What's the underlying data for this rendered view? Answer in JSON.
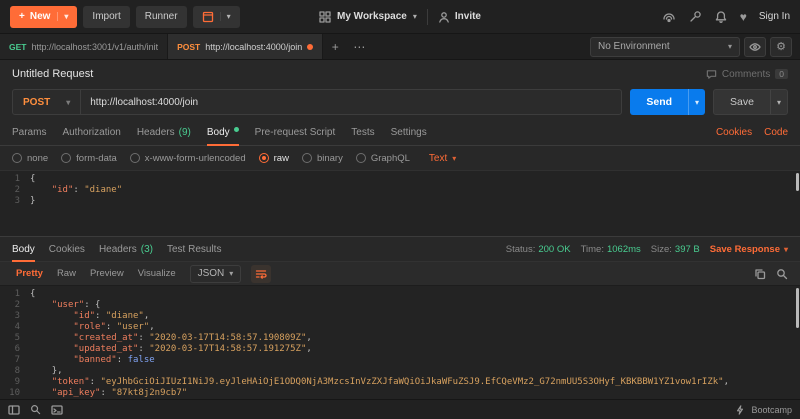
{
  "colors": {
    "accent": "#ff6c37",
    "send_blue": "#097bed",
    "get_green": "#49cc90",
    "post_orange": "#ff8f3e",
    "status_green": "#49cc90"
  },
  "topbar": {
    "new": "New",
    "import": "Import",
    "runner": "Runner",
    "workspace": "My Workspace",
    "invite": "Invite",
    "sign_in": "Sign In"
  },
  "tabstrip": {
    "tabs": [
      {
        "method": "GET",
        "url": "http://localhost:3001/v1/auth/init",
        "active": false,
        "unsaved": false
      },
      {
        "method": "POST",
        "url": "http://localhost:4000/join",
        "active": true,
        "unsaved": true
      }
    ],
    "environment": "No Environment"
  },
  "request": {
    "title": "Untitled Request",
    "comments_label": "Comments",
    "comments_count": "0",
    "method": "POST",
    "url": "http://localhost:4000/join",
    "send_label": "Send",
    "save_label": "Save",
    "tabs": [
      {
        "label": "Params"
      },
      {
        "label": "Authorization"
      },
      {
        "label": "Headers",
        "count": "(9)"
      },
      {
        "label": "Body",
        "dot": true,
        "active": true
      },
      {
        "label": "Pre-request Script"
      },
      {
        "label": "Tests"
      },
      {
        "label": "Settings"
      }
    ],
    "cookies_label": "Cookies",
    "code_label": "Code",
    "modes": [
      "none",
      "form-data",
      "x-www-form-urlencoded",
      "raw",
      "binary",
      "GraphQL"
    ],
    "selected_mode": "raw",
    "raw_format": "Text",
    "body": {
      "id": "diane"
    }
  },
  "response": {
    "tabs": [
      {
        "label": "Body",
        "active": true
      },
      {
        "label": "Cookies"
      },
      {
        "label": "Headers",
        "count": "(3)"
      },
      {
        "label": "Test Results"
      }
    ],
    "status_label": "Status:",
    "status_value": "200 OK",
    "time_label": "Time:",
    "time_value": "1062ms",
    "size_label": "Size:",
    "size_value": "397 B",
    "save_response_label": "Save Response",
    "view_tabs": [
      "Pretty",
      "Raw",
      "Preview",
      "Visualize"
    ],
    "selected_view": "Pretty",
    "format": "JSON",
    "body": {
      "user": {
        "id": "diane",
        "role": "user",
        "created_at": "2020-03-17T14:58:57.190809Z",
        "updated_at": "2020-03-17T14:58:57.191275Z",
        "banned": false
      },
      "token": "eyJhbGciOiJIUzI1NiJ9.eyJleHAiOjE1ODQ0NjA3MzcsInVzZXJfaWQiOiJkaWFuZSJ9.EfCQeVMz2_G72nmUU5S3OHyf_KBKBBW1YZ1vow1rIZk",
      "api_key": "87kt8j2n9cb7"
    }
  },
  "statusbar": {
    "bootcamp": "Bootcamp"
  }
}
